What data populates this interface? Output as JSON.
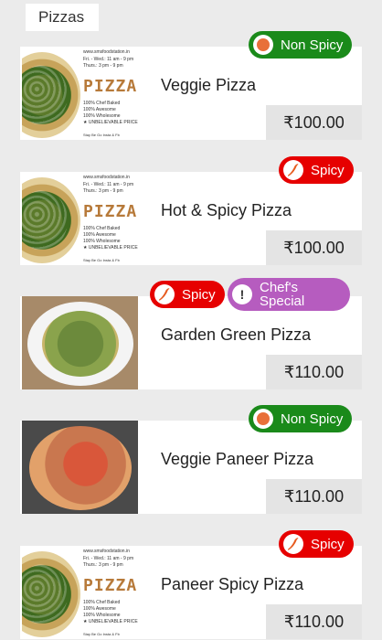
{
  "category": "Pizzas",
  "poster": {
    "word": "PIZZAS",
    "website": "www.smsfoodstation.in",
    "hours": [
      "Fri. - Wed.: 11 am - 9 pm",
      "Thurs.: 3 pm - 9 pm"
    ],
    "taglines": [
      "100% Chef Baked",
      "100% Awesome",
      "100% Wholesome",
      "★ UNBELIEVABLE PRICES!"
    ],
    "footer": "Stay Be Go Insta & Fb"
  },
  "items": [
    {
      "name": "Veggie Pizza",
      "price": "₹100.00",
      "badges": [
        {
          "type": "veg",
          "label": "Non Spicy",
          "icon": "dot-icon"
        }
      ],
      "image": "poster"
    },
    {
      "name": "Hot & Spicy Pizza",
      "price": "₹100.00",
      "badges": [
        {
          "type": "spicy",
          "label": "Spicy",
          "icon": "chili-icon"
        }
      ],
      "image": "poster"
    },
    {
      "name": "Garden Green Pizza",
      "price": "₹110.00",
      "badges": [
        {
          "type": "spicy",
          "label": "Spicy",
          "icon": "chili-icon"
        },
        {
          "type": "chef",
          "label": "Chef's Special",
          "icon": "exclamation-icon"
        }
      ],
      "image": "plate"
    },
    {
      "name": "Veggie Paneer Pizza",
      "price": "₹110.00",
      "badges": [
        {
          "type": "veg",
          "label": "Non Spicy",
          "icon": "dot-icon"
        }
      ],
      "image": "paneer"
    },
    {
      "name": "Paneer Spicy Pizza",
      "price": "₹110.00",
      "badges": [
        {
          "type": "spicy",
          "label": "Spicy",
          "icon": "chili-icon"
        }
      ],
      "image": "poster"
    }
  ],
  "colors": {
    "veg": "#1a8a1a",
    "spicy": "#e60000",
    "chef": "#b65cbf"
  }
}
